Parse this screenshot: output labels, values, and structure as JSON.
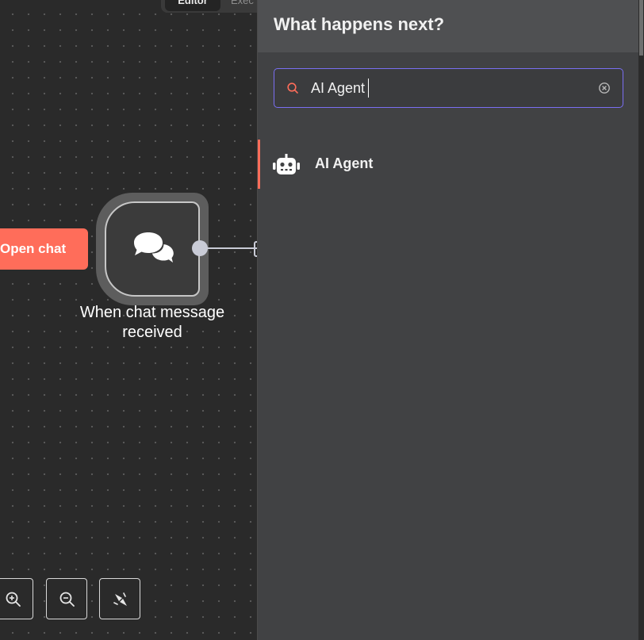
{
  "canvas": {
    "tabs": [
      {
        "label": "Editor"
      },
      {
        "label": "Exec"
      }
    ],
    "open_chat_label": "Open chat",
    "node": {
      "label": "When chat message received",
      "icon": "chat-bubbles-icon"
    },
    "controls": [
      {
        "icon": "zoom-in-icon"
      },
      {
        "icon": "zoom-out-icon"
      },
      {
        "icon": "tidy-up-icon"
      }
    ]
  },
  "panel": {
    "title": "What happens next?",
    "search": {
      "value": "AI Agent",
      "placeholder": ""
    },
    "results": [
      {
        "label": "AI Agent",
        "icon": "robot-icon"
      }
    ]
  },
  "colors": {
    "accent": "#ff6d5a",
    "focus": "#7a6ff2",
    "canvas_bg": "#2a2a2a",
    "panel_bg": "#414244"
  }
}
